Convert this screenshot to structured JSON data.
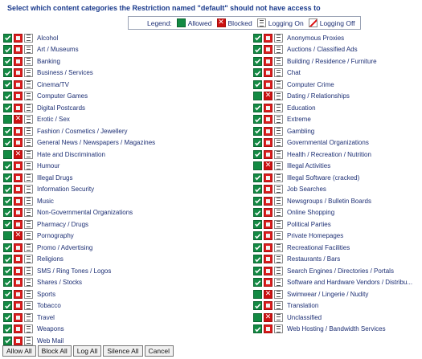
{
  "title": "Select which content categories the Restriction named \"default\" should not have access to",
  "legend": {
    "label": "Legend:",
    "allowed": "Allowed",
    "blocked": "Blocked",
    "logging_on": "Logging On",
    "logging_off": "Logging Off"
  },
  "colors": {
    "allowed": "#138a43",
    "blocked": "#dc1d1d",
    "text": "#1d2f74"
  },
  "left_categories": [
    {
      "name": "Alcohol",
      "status": "allowed"
    },
    {
      "name": "Art / Museums",
      "status": "allowed"
    },
    {
      "name": "Banking",
      "status": "allowed"
    },
    {
      "name": "Business / Services",
      "status": "allowed"
    },
    {
      "name": "Cinema/TV",
      "status": "allowed"
    },
    {
      "name": "Computer Games",
      "status": "allowed"
    },
    {
      "name": "Digital Postcards",
      "status": "allowed"
    },
    {
      "name": "Erotic / Sex",
      "status": "blocked"
    },
    {
      "name": "Fashion / Cosmetics / Jewellery",
      "status": "allowed"
    },
    {
      "name": "General News / Newspapers / Magazines",
      "status": "allowed"
    },
    {
      "name": "Hate and Discrimination",
      "status": "blocked"
    },
    {
      "name": "Humour",
      "status": "allowed"
    },
    {
      "name": "Illegal Drugs",
      "status": "allowed"
    },
    {
      "name": "Information Security",
      "status": "allowed"
    },
    {
      "name": "Music",
      "status": "allowed"
    },
    {
      "name": "Non-Governmental Organizations",
      "status": "allowed"
    },
    {
      "name": "Pharmacy / Drugs",
      "status": "allowed"
    },
    {
      "name": "Pornography",
      "status": "blocked"
    },
    {
      "name": "Promo / Advertising",
      "status": "allowed"
    },
    {
      "name": "Religions",
      "status": "allowed"
    },
    {
      "name": "SMS / Ring Tones / Logos",
      "status": "allowed"
    },
    {
      "name": "Shares / Stocks",
      "status": "allowed"
    },
    {
      "name": "Sports",
      "status": "allowed"
    },
    {
      "name": "Tobacco",
      "status": "allowed"
    },
    {
      "name": "Travel",
      "status": "allowed"
    },
    {
      "name": "Weapons",
      "status": "allowed"
    },
    {
      "name": "Web Mail",
      "status": "allowed"
    }
  ],
  "right_categories": [
    {
      "name": "Anonymous Proxies",
      "status": "allowed"
    },
    {
      "name": "Auctions / Classified Ads",
      "status": "allowed"
    },
    {
      "name": "Building / Residence / Furniture",
      "status": "allowed"
    },
    {
      "name": "Chat",
      "status": "allowed"
    },
    {
      "name": "Computer Crime",
      "status": "allowed"
    },
    {
      "name": "Dating / Relationships",
      "status": "blocked"
    },
    {
      "name": "Education",
      "status": "allowed"
    },
    {
      "name": "Extreme",
      "status": "allowed"
    },
    {
      "name": "Gambling",
      "status": "allowed"
    },
    {
      "name": "Governmental Organizations",
      "status": "allowed"
    },
    {
      "name": "Health / Recreation / Nutrition",
      "status": "allowed"
    },
    {
      "name": "Illegal Activities",
      "status": "blocked"
    },
    {
      "name": "Illegal Software (cracked)",
      "status": "allowed"
    },
    {
      "name": "Job Searches",
      "status": "allowed"
    },
    {
      "name": "Newsgroups / Bulletin Boards",
      "status": "allowed"
    },
    {
      "name": "Online Shopping",
      "status": "allowed"
    },
    {
      "name": "Political Parties",
      "status": "allowed"
    },
    {
      "name": "Private Homepages",
      "status": "allowed"
    },
    {
      "name": "Recreational Facilities",
      "status": "allowed"
    },
    {
      "name": "Restaurants / Bars",
      "status": "allowed"
    },
    {
      "name": "Search Engines / Directories / Portals",
      "status": "allowed"
    },
    {
      "name": "Software and Hardware Vendors / Distribu...",
      "status": "allowed"
    },
    {
      "name": "Swimwear / Lingerie / Nudity",
      "status": "blocked"
    },
    {
      "name": "Translation",
      "status": "allowed"
    },
    {
      "name": "Unclassified",
      "status": "blocked"
    },
    {
      "name": "Web Hosting / Bandwidth Services",
      "status": "allowed"
    }
  ],
  "buttons": {
    "allow_all": "Allow All",
    "block_all": "Block All",
    "log_all": "Log All",
    "silence_all": "Silence All",
    "cancel": "Cancel"
  }
}
